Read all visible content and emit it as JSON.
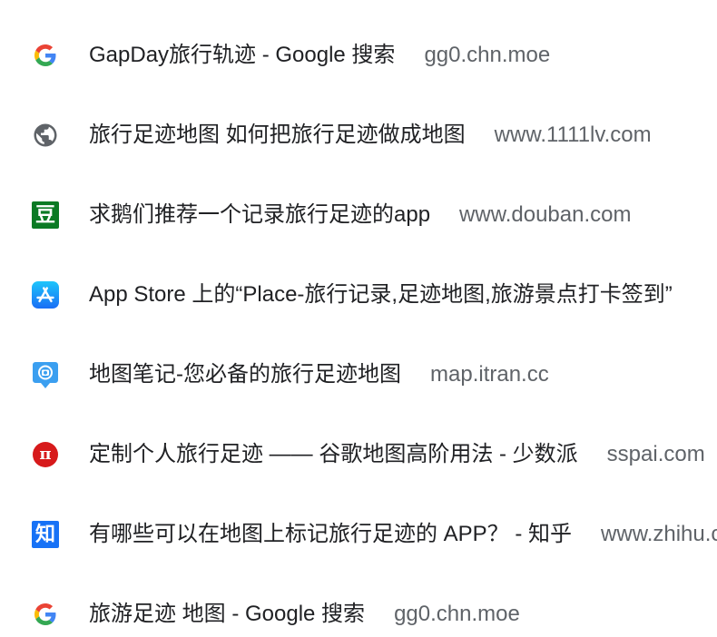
{
  "history_items": [
    {
      "title": "GapDay旅行轨迹 - Google 搜索",
      "url": "gg0.chn.moe",
      "icon": "google-g-icon"
    },
    {
      "title": "旅行足迹地图 如何把旅行足迹做成地图",
      "url": "www.1111lv.com",
      "icon": "globe-icon"
    },
    {
      "title": "求鹅们推荐一个记录旅行足迹的app",
      "url": "www.douban.com",
      "icon": "douban-icon",
      "icon_text": "豆"
    },
    {
      "title": "App Store 上的“Place-旅行记录,足迹地图,旅游景点打卡签到”",
      "url": "",
      "icon": "app-store-icon"
    },
    {
      "title": "地图笔记-您必备的旅行足迹地图",
      "url": "map.itran.cc",
      "icon": "itran-map-pin-icon"
    },
    {
      "title": "定制个人旅行足迹 —— 谷歌地图高阶用法 - 少数派",
      "url": "sspai.com",
      "icon": "sspai-icon",
      "icon_text": "π"
    },
    {
      "title": "有哪些可以在地图上标记旅行足迹的 APP？ - 知乎",
      "url": "www.zhihu.com",
      "icon": "zhihu-icon",
      "icon_text": "知"
    },
    {
      "title": "旅游足迹 地图 - Google 搜索",
      "url": "gg0.chn.moe",
      "icon": "google-g-icon"
    }
  ],
  "colors": {
    "title_text": "#202124",
    "url_text": "#5f6368",
    "douban_green": "#0b7a24",
    "zhihu_blue": "#1772f6",
    "sspai_red": "#d71a1b",
    "app_store_blue": "#1a8cf8",
    "globe_gray": "#5f6368"
  }
}
